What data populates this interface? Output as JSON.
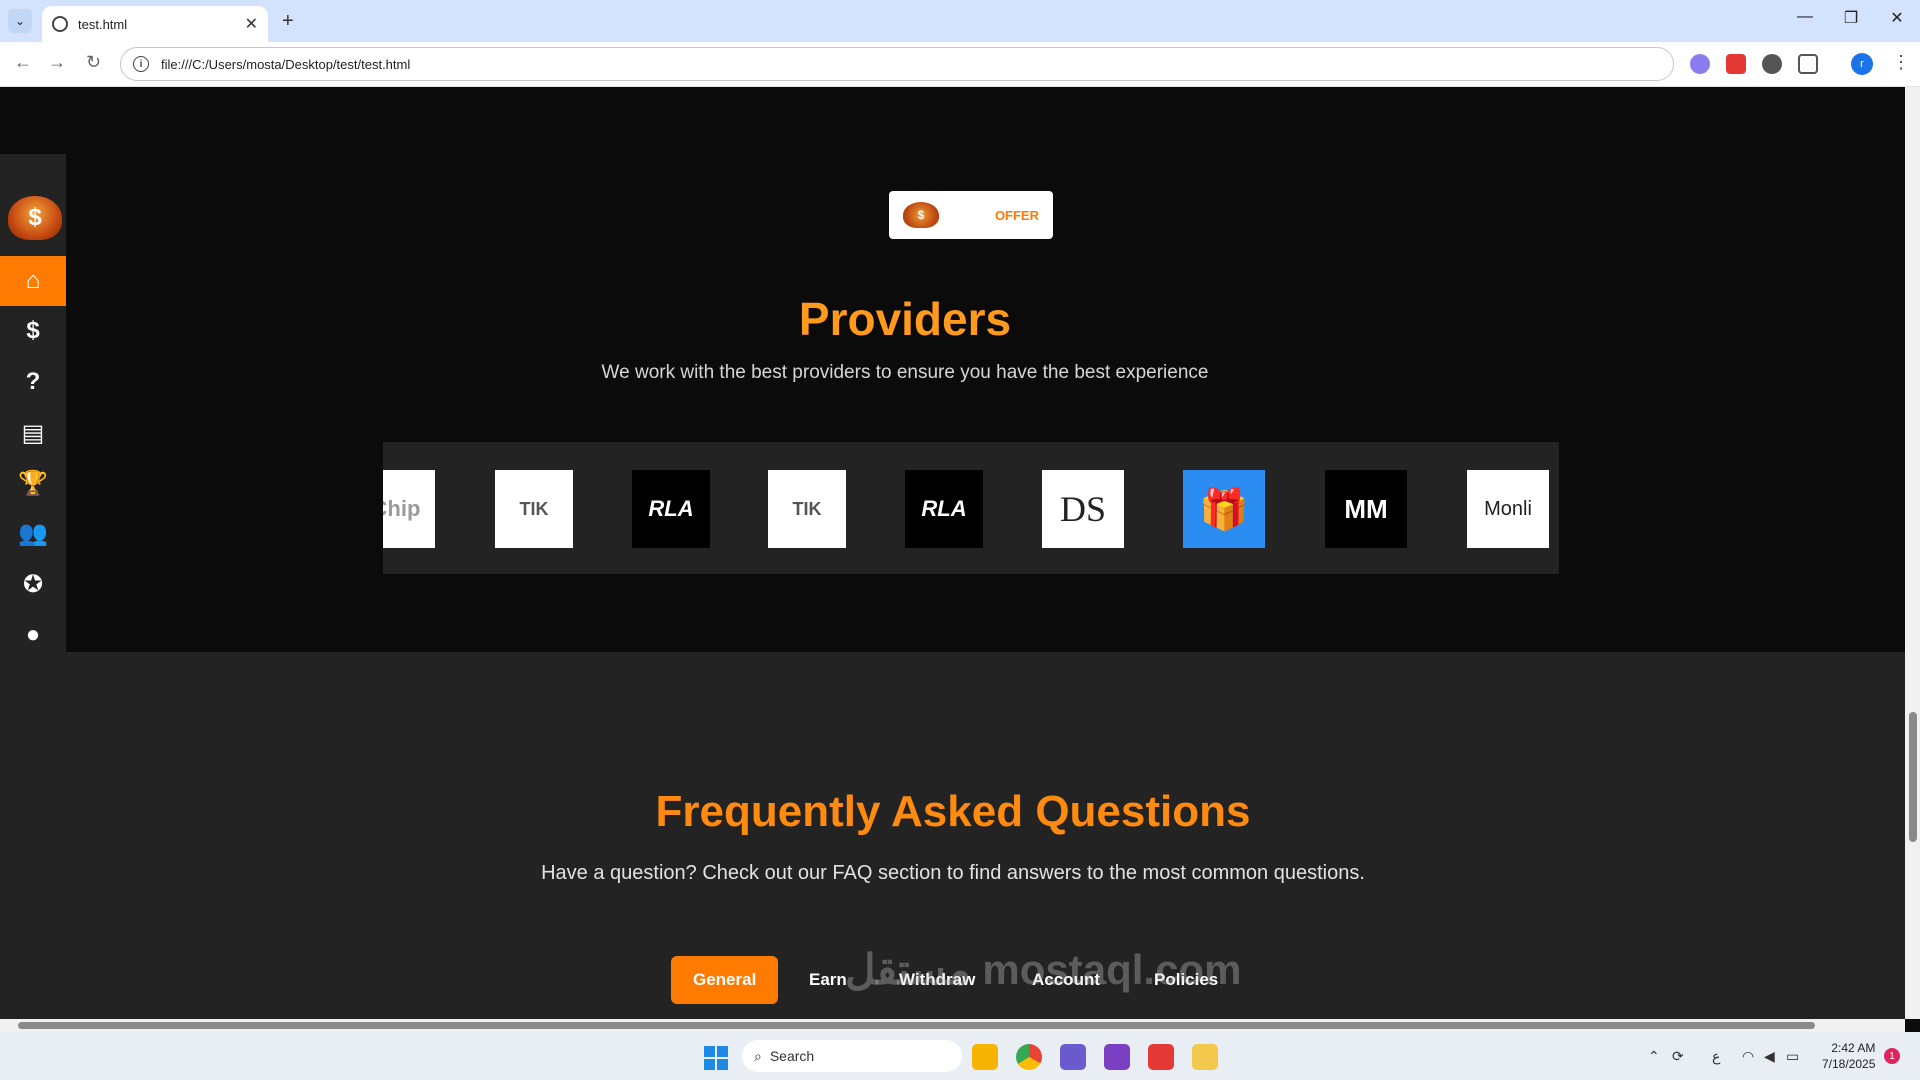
{
  "browser": {
    "tab_title": "test.html",
    "url": "file:///C:/Users/mosta/Desktop/test/test.html",
    "profile_initial": "r"
  },
  "offer": {
    "label": "OFFER",
    "logo_glyph": "$"
  },
  "sidebar": {
    "logo_glyph": "$",
    "items": [
      {
        "icon": "home-icon",
        "glyph": "⌂",
        "active": true
      },
      {
        "icon": "dollar-icon",
        "glyph": "$",
        "active": false
      },
      {
        "icon": "clipboard-question-icon",
        "glyph": "?",
        "active": false
      },
      {
        "icon": "cash-register-icon",
        "glyph": "▤",
        "active": false
      },
      {
        "icon": "trophy-icon",
        "glyph": "🏆",
        "active": false
      },
      {
        "icon": "users-icon",
        "glyph": "👥",
        "active": false
      },
      {
        "icon": "award-icon",
        "glyph": "✪",
        "active": false
      },
      {
        "icon": "user-circle-icon",
        "glyph": "●",
        "active": false
      }
    ]
  },
  "providers": {
    "title": "Providers",
    "subtitle": "We work with the best providers to ensure you have the best experience",
    "logos": [
      {
        "name": "chip-logo",
        "text": "Chip",
        "bg": "#ffffff",
        "fg": "#9a9a9a"
      },
      {
        "name": "tik-logo",
        "text": "TIK",
        "bg": "#ffffff",
        "fg": "#555555"
      },
      {
        "name": "rla-logo",
        "text": "RLA",
        "bg": "#000000",
        "fg": "#ffffff"
      },
      {
        "name": "tik-logo",
        "text": "TIK",
        "bg": "#ffffff",
        "fg": "#555555"
      },
      {
        "name": "rla-logo",
        "text": "RLA",
        "bg": "#000000",
        "fg": "#ffffff"
      },
      {
        "name": "ds-logo",
        "text": "DS",
        "bg": "#ffffff",
        "fg": "#222222"
      },
      {
        "name": "gift-logo",
        "text": "🎁",
        "bg": "#2b8cf2",
        "fg": "#ff8a10"
      },
      {
        "name": "mm-logo",
        "text": "MM",
        "bg": "#000000",
        "fg": "#ffffff"
      },
      {
        "name": "monli-logo",
        "text": "Monli",
        "bg": "#ffffff",
        "fg": "#222222"
      }
    ]
  },
  "faq": {
    "title": "Frequently Asked Questions",
    "subtitle": "Have a question? Check out our FAQ section to find answers to the most common questions.",
    "tabs": [
      "General",
      "Earn",
      "Withdraw",
      "Account",
      "Policies"
    ],
    "active_tab": "General"
  },
  "watermark": "مستقل mostaql.com",
  "taskbar": {
    "search_placeholder": "Search",
    "time": "2:42 AM",
    "date": "7/18/2025",
    "notification_count": "1",
    "lang": "ع"
  },
  "colors": {
    "accent": "#ff7a00",
    "title_orange": "#ff9a1c",
    "sidebar_bg": "#232323",
    "page_bg": "#0b0b0b"
  }
}
